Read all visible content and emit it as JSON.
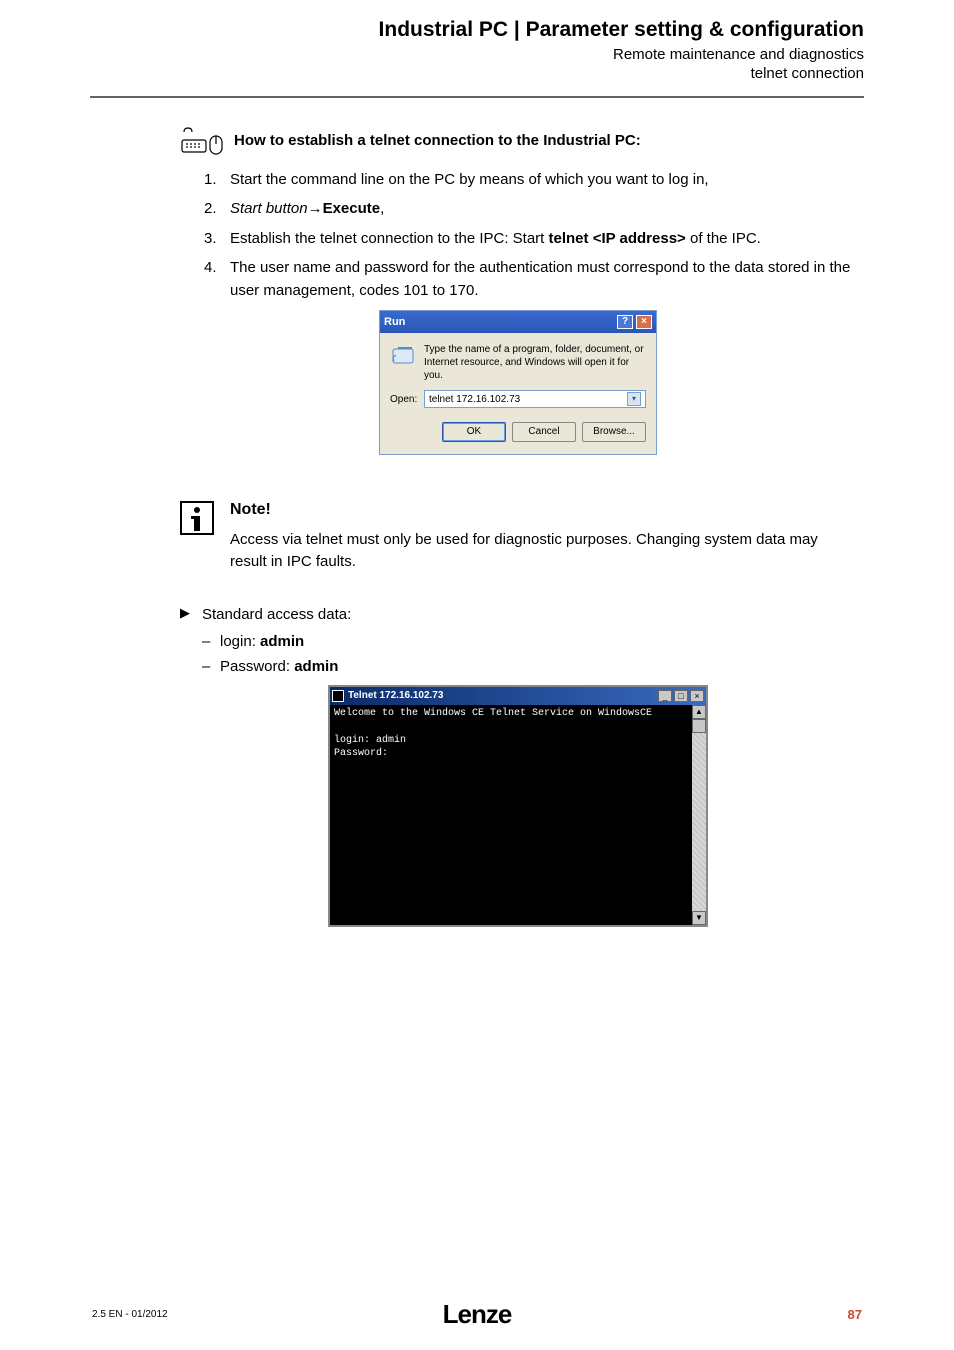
{
  "header": {
    "title": "Industrial PC | Parameter setting & configuration",
    "sub1": "Remote maintenance and diagnostics",
    "sub2": "telnet connection"
  },
  "howto_heading": "How to establish a telnet connection to the Industrial PC:",
  "steps": {
    "s1_num": "1.",
    "s1_txt": "Start the command line on the PC by means of which you want to log in,",
    "s2_num": "2.",
    "s2_start_btn": "Start button",
    "s2_execute": "Execute",
    "s2_comma": ",",
    "s3_num": "3.",
    "s3_pre": "Establish the telnet connection to the IPC: Start ",
    "s3_cmd": "telnet <IP address>",
    "s3_post": " of the IPC.",
    "s4_num": "4.",
    "s4_txt": "The user name and password for the authentication must correspond to the data stored in the user management, codes 101 to 170."
  },
  "run_dialog": {
    "title": "Run",
    "help": "?",
    "close": "×",
    "desc": "Type the name of a program, folder, document, or Internet resource, and Windows will open it for you.",
    "open_label": "Open:",
    "open_value": "telnet 172.16.102.73",
    "btn_ok": "OK",
    "btn_cancel": "Cancel",
    "btn_browse": "Browse..."
  },
  "note": {
    "title": "Note!",
    "text": "Access via telnet must only be used for diagnostic purposes. Changing system data may result in IPC faults."
  },
  "access": {
    "std_label": "Standard access data:",
    "login_label": "login: ",
    "login_value": "admin",
    "pw_label": "Password: ",
    "pw_value": "admin"
  },
  "telnet": {
    "title": "Telnet 172.16.102.73",
    "welcome": "Welcome to the Windows CE Telnet Service on WindowsCE",
    "login": "login: admin",
    "password": "Password:",
    "min": "_",
    "max": "□",
    "close": "×",
    "up": "▲",
    "down": "▼"
  },
  "footer": {
    "left": "2.5 EN - 01/2012",
    "center": "Lenze",
    "right": "87"
  }
}
